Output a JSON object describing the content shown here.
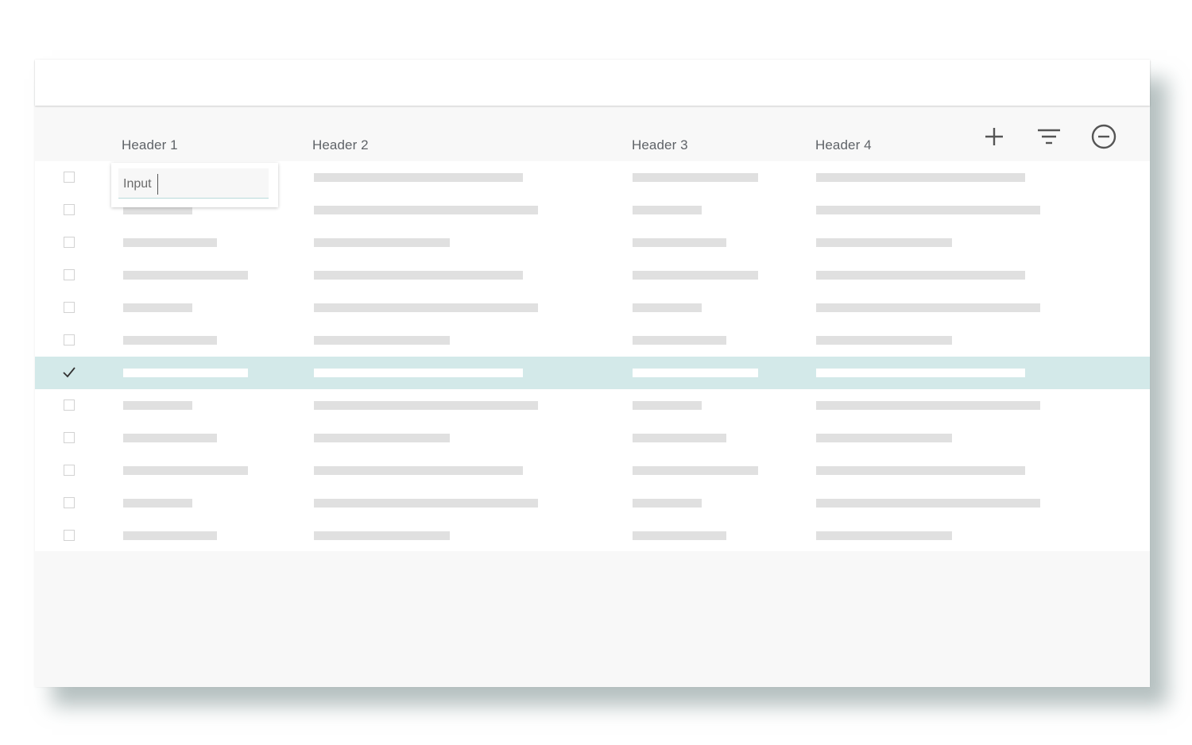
{
  "table": {
    "headers": [
      "Header 1",
      "Header 2",
      "Header 3",
      "Header 4"
    ],
    "toolbar": {
      "add_icon": "plus-icon",
      "filter_icon": "filter-icon",
      "remove_icon": "minus-circle-icon"
    },
    "rows_total": 12,
    "selected_row_index": 6
  },
  "inline_editor": {
    "value": "Input"
  },
  "colors": {
    "selected_row": "#d3e9e9",
    "placeholder_bar": "#e0e0e0",
    "icon": "#555555"
  }
}
